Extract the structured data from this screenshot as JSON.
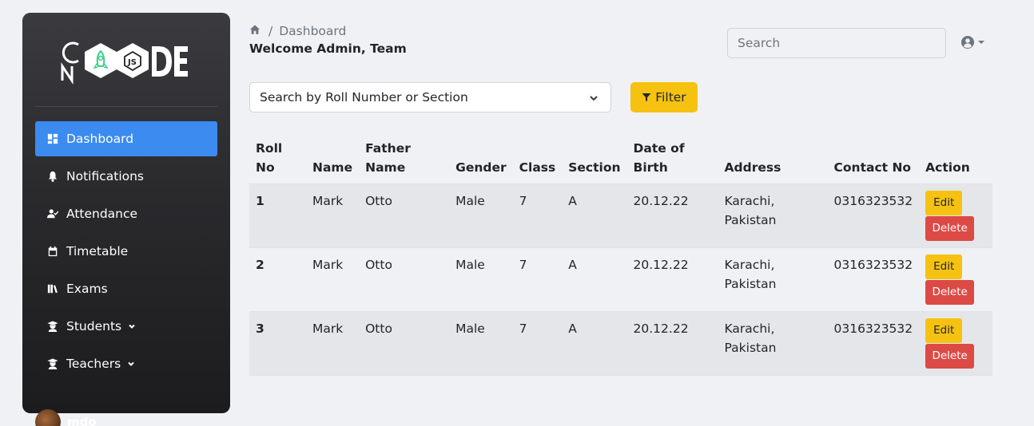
{
  "sidebar": {
    "logo_alt": "CNODE",
    "items": [
      {
        "label": "Dashboard",
        "icon": "dashboard-icon",
        "active": true
      },
      {
        "label": "Notifications",
        "icon": "bell-icon"
      },
      {
        "label": "Attendance",
        "icon": "user-check-icon"
      },
      {
        "label": "Timetable",
        "icon": "calendar-icon"
      },
      {
        "label": "Exams",
        "icon": "books-icon"
      },
      {
        "label": "Students",
        "icon": "graduate-icon",
        "has_submenu": true
      },
      {
        "label": "Teachers",
        "icon": "graduate-icon",
        "has_submenu": true
      }
    ],
    "user": {
      "name": "mdo"
    }
  },
  "header": {
    "breadcrumb": {
      "separator": "/",
      "current": "Dashboard"
    },
    "welcome": "Welcome Admin, Team",
    "search_placeholder": "Search"
  },
  "filter": {
    "select_value": "Search by Roll Number or Section",
    "button_label": "Filter"
  },
  "table": {
    "headers": {
      "roll_1": "Roll",
      "roll_2": "No",
      "name": "Name",
      "father_1": "Father",
      "father_2": "Name",
      "gender": "Gender",
      "class": "Class",
      "section": "Section",
      "dob_1": "Date of",
      "dob_2": "Birth",
      "address": "Address",
      "contact": "Contact No",
      "action": "Action"
    },
    "rows": [
      {
        "roll": "1",
        "name": "Mark",
        "father": "Otto",
        "gender": "Male",
        "class": "7",
        "section": "A",
        "dob": "20.12.22",
        "address_1": "Karachi,",
        "address_2": "Pakistan",
        "contact": "0316323532",
        "edit": "Edit",
        "delete": "Delete"
      },
      {
        "roll": "2",
        "name": "Mark",
        "father": "Otto",
        "gender": "Male",
        "class": "7",
        "section": "A",
        "dob": "20.12.22",
        "address_1": "Karachi,",
        "address_2": "Pakistan",
        "contact": "0316323532",
        "edit": "Edit",
        "delete": "Delete"
      },
      {
        "roll": "3",
        "name": "Mark",
        "father": "Otto",
        "gender": "Male",
        "class": "7",
        "section": "A",
        "dob": "20.12.22",
        "address_1": "Karachi,",
        "address_2": "Pakistan",
        "contact": "0316323532",
        "edit": "Edit",
        "delete": "Delete"
      }
    ]
  },
  "colors": {
    "active_nav": "#3b8bf0",
    "warning": "#f5c211",
    "danger": "#dc4a45",
    "logo_accent": "#3ecf8e"
  }
}
